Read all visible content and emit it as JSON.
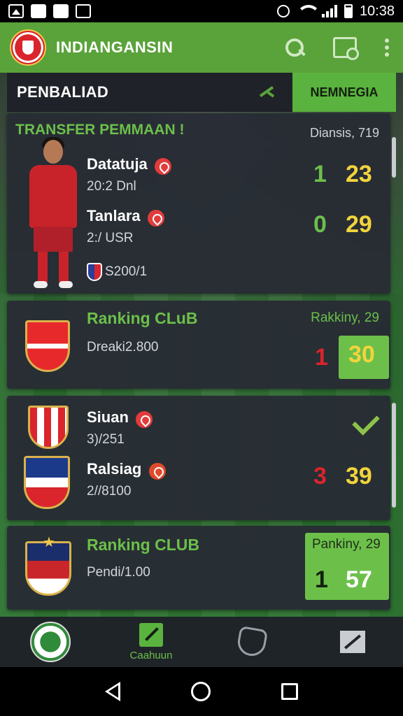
{
  "status_bar": {
    "time": "10:38",
    "left_icons": [
      "image-icon",
      "edit-icon",
      "sim-icon",
      "game-icon"
    ],
    "right_icons": [
      "alarm-icon",
      "wifi-icon",
      "signal-icon",
      "battery-icon"
    ]
  },
  "app_bar": {
    "title": "INDIANGANSIN",
    "icons": [
      "search-icon",
      "image-search-icon",
      "more-vert-icon"
    ]
  },
  "section": {
    "title": "PENBALIAD",
    "tab_label": "NEMNEGIA"
  },
  "cards": [
    {
      "heading": "TRANSFER PEMMAAN !",
      "meta": "Diansis, 719",
      "rows": [
        {
          "name": "Datatuja",
          "sub": "20:2 Dnl",
          "score_left": "1",
          "score_right": "23"
        },
        {
          "name": "Tanlara",
          "sub": "2:/ USR",
          "score_left": "0",
          "score_right": "29"
        }
      ],
      "footer": "S200/1"
    },
    {
      "heading": "Ranking CLuB",
      "meta": "Rakkiny, 29",
      "sub": "Dreaki2.800",
      "score_left": "1",
      "score_right": "30"
    },
    {
      "rows": [
        {
          "name": "Siuan",
          "sub": "3)/251"
        },
        {
          "name": "Ralsiag",
          "sub": "2//8100",
          "score_left": "3",
          "score_right": "39"
        }
      ]
    },
    {
      "heading": "Ranking CLUB",
      "sub": "Pendi/1.00",
      "box_label": "Pankiny, 29",
      "score_left": "1",
      "score_right": "57"
    }
  ],
  "bottom_nav": {
    "active_label": "Caahuun"
  },
  "colors": {
    "accent": "#5ab33e",
    "app_bar": "#5aa23a",
    "score_yellow": "#f2d43c",
    "score_red": "#d9252b"
  }
}
